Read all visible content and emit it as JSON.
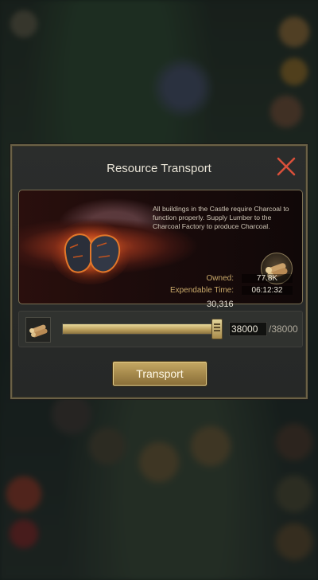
{
  "dialog": {
    "title": "Resource Transport",
    "description": "All buildings in the Castle require Charcoal to function properly. Supply Lumber to the Charcoal Factory to produce Charcoal.",
    "owned_label": "Owned:",
    "owned_value": "77.8K",
    "expend_label": "Expendable Time:",
    "expend_value": "06:12:32",
    "hero_icon": "charcoal-icon",
    "resource_icon": "lumber-icon"
  },
  "slider": {
    "current_label": "30,316",
    "input_value": "38000",
    "max_label": "/38000",
    "fill_fraction": 1.0
  },
  "actions": {
    "transport_label": "Transport"
  },
  "colors": {
    "accent_gold": "#c4a763",
    "close_red": "#d9503a",
    "label_gold": "#c9a96a"
  }
}
